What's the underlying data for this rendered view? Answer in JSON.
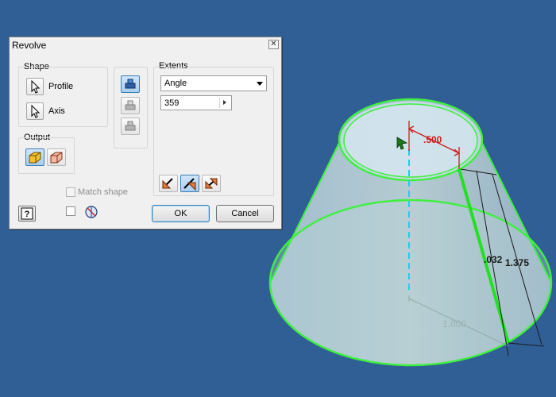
{
  "dialog": {
    "title": "Revolve",
    "shape": {
      "label": "Shape",
      "profile_label": "Profile",
      "axis_label": "Axis"
    },
    "output": {
      "label": "Output"
    },
    "extents": {
      "label": "Extents",
      "type_value": "Angle",
      "angle_value": "359"
    },
    "match_shape_label": "Match shape",
    "ok_label": "OK",
    "cancel_label": "Cancel"
  },
  "viewport": {
    "dims": {
      "radius_top": ".500",
      "height_slant": "1.375",
      "thickness": ".032",
      "base": "1.000"
    },
    "colors": {
      "background": "#305f96",
      "edge_highlight": "#3ff03f",
      "dimension": "#cc1e1e",
      "axis": "#12d6e6"
    }
  }
}
